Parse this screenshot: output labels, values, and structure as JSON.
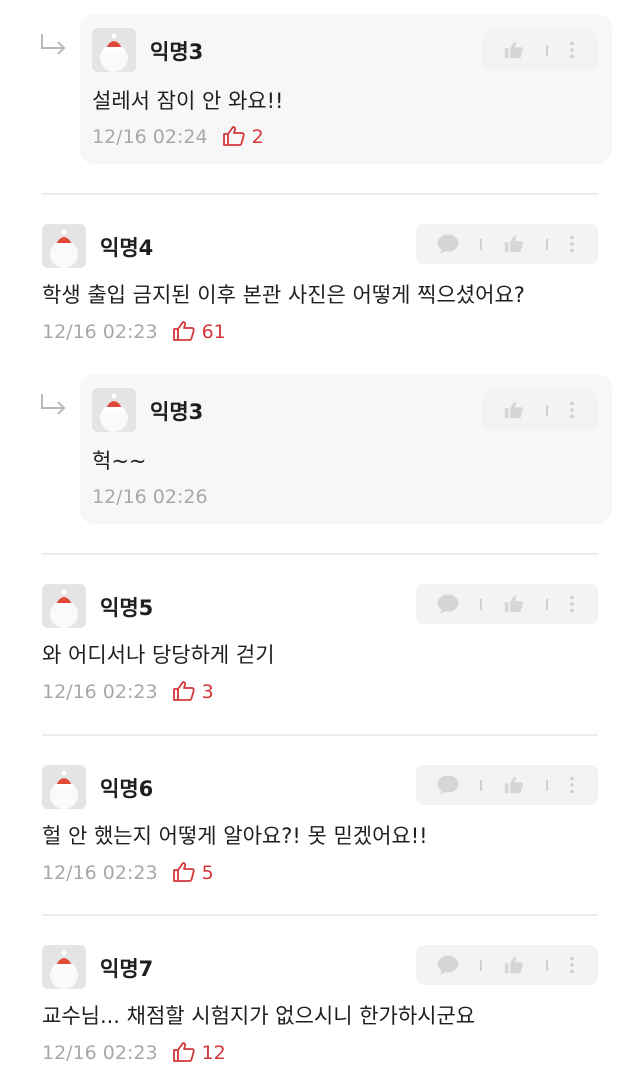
{
  "comments": [
    {
      "author": "익명3",
      "text": "설레서 잠이 안 와요!!",
      "time": "12/16 02:24",
      "votes": "2",
      "reply": true
    },
    {
      "author": "익명4",
      "text": "학생 출입 금지된 이후 본관 사진은 어떻게 찍으셨어요?",
      "time": "12/16 02:23",
      "votes": "61",
      "reply": false
    },
    {
      "author": "익명3",
      "text": "헉~~",
      "time": "12/16 02:26",
      "votes": "",
      "reply": true
    },
    {
      "author": "익명5",
      "text": "와 어디서나 당당하게 걷기",
      "time": "12/16 02:23",
      "votes": "3",
      "reply": false
    },
    {
      "author": "익명6",
      "text": "헐 안 했는지 어떻게 알아요?! 못 믿겠어요!!",
      "time": "12/16 02:23",
      "votes": "5",
      "reply": false
    },
    {
      "author": "익명7",
      "text": "교수님... 채점할 시험지가 없으시니 한가하시군요",
      "time": "12/16 02:23",
      "votes": "12",
      "reply": false
    }
  ],
  "icons": {
    "reply": "reply-arrow-icon",
    "comment": "speech-bubble-icon",
    "like": "thumbs-up-icon",
    "more": "vertical-dots-icon",
    "vote": "thumbs-up-outline-icon"
  },
  "colors": {
    "vote": "#d3373a",
    "time": "#a8a8a8",
    "reply_bg": "#f7f7f7"
  }
}
